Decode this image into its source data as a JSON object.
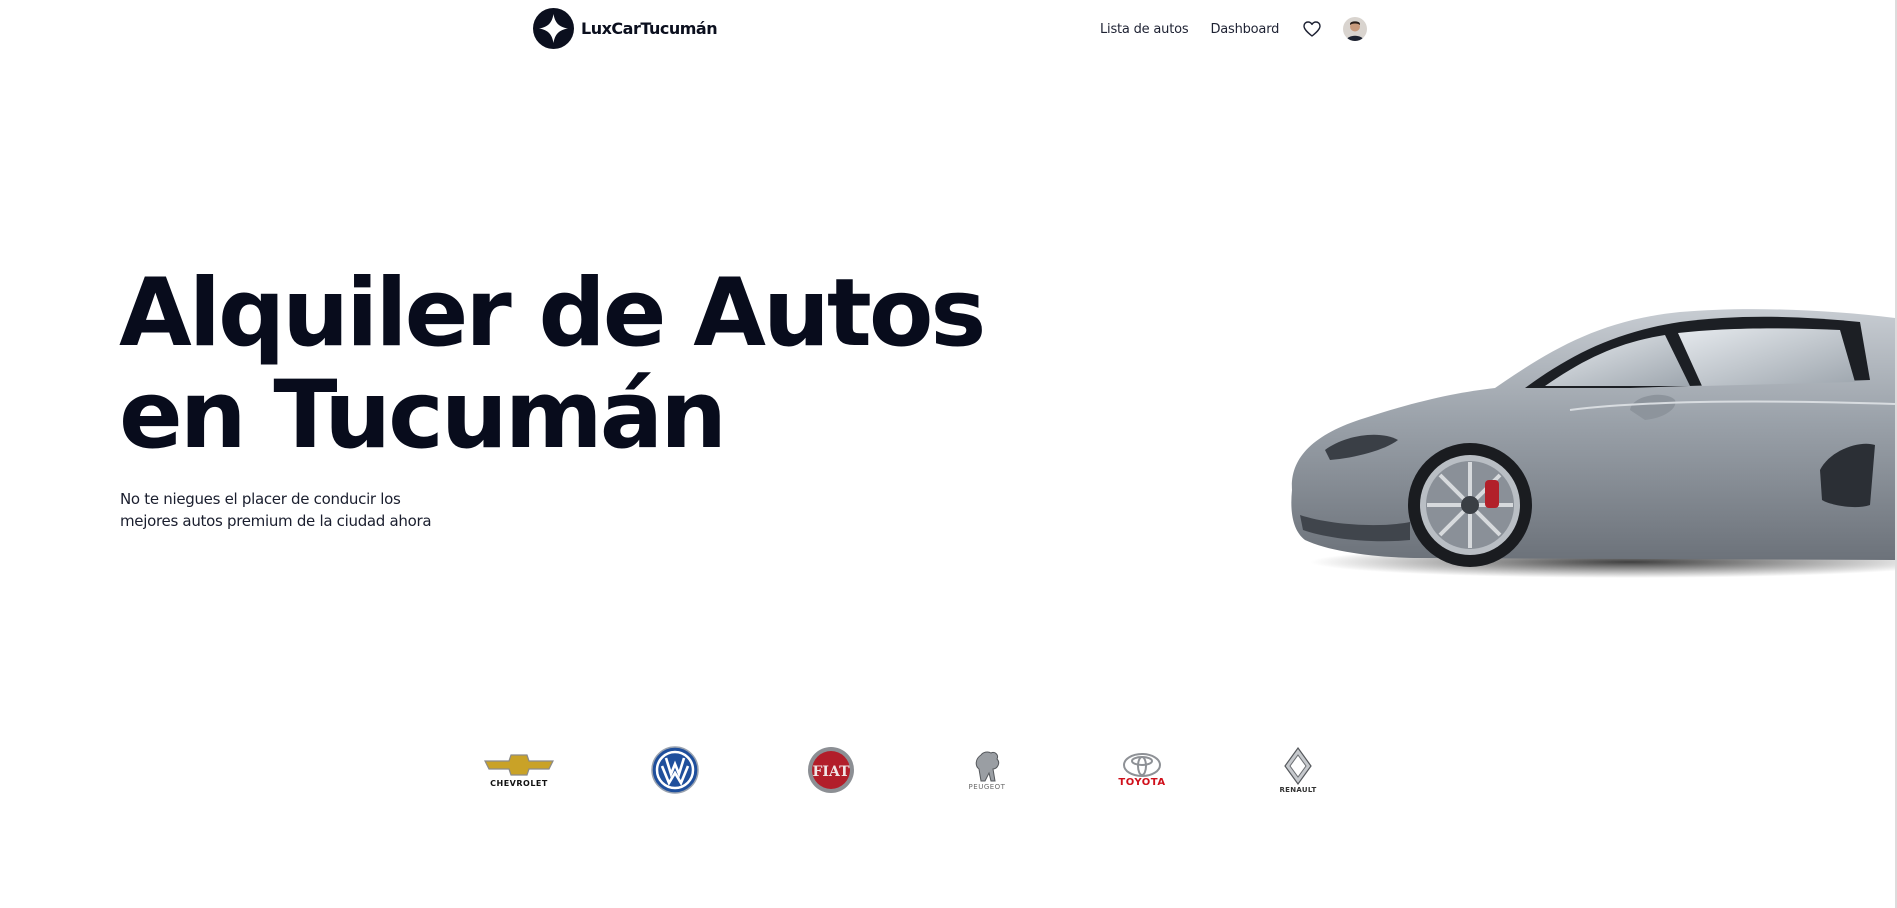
{
  "header": {
    "brand_name": "LuxCarTucumán",
    "nav": {
      "cars_list": "Lista de autos",
      "dashboard": "Dashboard"
    },
    "icons": [
      "logo-mark",
      "heart-icon",
      "avatar"
    ]
  },
  "hero": {
    "title_line1": "Alquiler de Autos",
    "title_line2": "en Tucumán",
    "subtitle_line1": "No te niegues el placer de conducir los",
    "subtitle_line2": "mejores autos premium de la ciudad ahora",
    "image": "silver-sports-car"
  },
  "brands": [
    {
      "name": "CHEVROLET",
      "color": "#c9a227"
    },
    {
      "name": "VW",
      "color": "#1f4f9c"
    },
    {
      "name": "FIAT",
      "color": "#b21e2a"
    },
    {
      "name": "PEUGEOT",
      "color": "#6a6a6a"
    },
    {
      "name": "TOYOTA",
      "color": "#d0101b"
    },
    {
      "name": "RENAULT",
      "color": "#555555"
    }
  ],
  "colors": {
    "text_dark": "#080c1c",
    "background": "#ffffff"
  }
}
